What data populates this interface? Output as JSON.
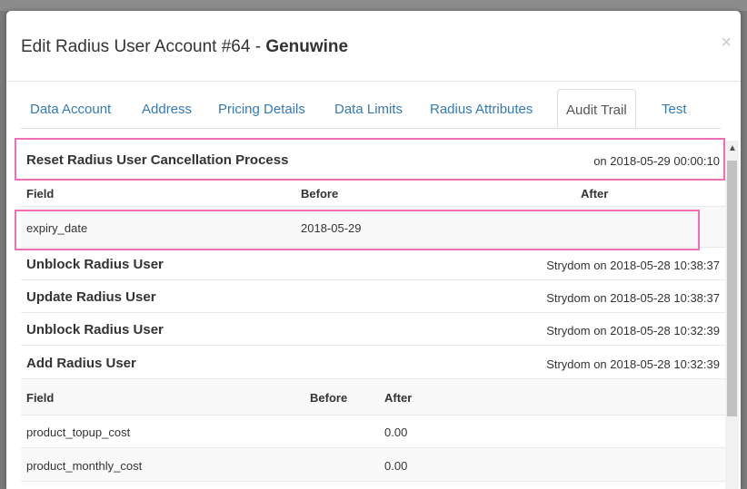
{
  "modal": {
    "title_prefix": "Edit Radius User Account #64 - ",
    "title_name": "Genuwine",
    "close_label": "×"
  },
  "tabs": [
    {
      "label": "Data Account"
    },
    {
      "label": "Address"
    },
    {
      "label": "Pricing Details"
    },
    {
      "label": "Data Limits"
    },
    {
      "label": "Radius Attributes"
    },
    {
      "label": "Audit Trail",
      "active": true
    },
    {
      "label": "Test"
    }
  ],
  "audit": {
    "entries": [
      {
        "title": "Reset Radius User Cancellation Process",
        "meta": "on 2018-05-29 00:00:10",
        "headers": {
          "field": "Field",
          "before": "Before",
          "after": "After"
        },
        "rows": [
          {
            "field": "expiry_date",
            "before": "2018-05-29",
            "after": ""
          }
        ]
      },
      {
        "title": "Unblock Radius User",
        "meta": "Strydom on 2018-05-28 10:38:37"
      },
      {
        "title": "Update Radius User",
        "meta": "Strydom on 2018-05-28 10:38:37"
      },
      {
        "title": "Unblock Radius User",
        "meta": "Strydom on 2018-05-28 10:32:39"
      },
      {
        "title": "Add Radius User",
        "meta": "Strydom on 2018-05-28 10:32:39",
        "headers": {
          "field": "Field",
          "before": "Before",
          "after": "After"
        },
        "rows": [
          {
            "field": "product_topup_cost",
            "before": "",
            "after": "0.00"
          },
          {
            "field": "product_monthly_cost",
            "before": "",
            "after": "0.00"
          }
        ]
      }
    ]
  },
  "colors": {
    "link": "#337ab7",
    "highlight": "#f06fb7"
  }
}
